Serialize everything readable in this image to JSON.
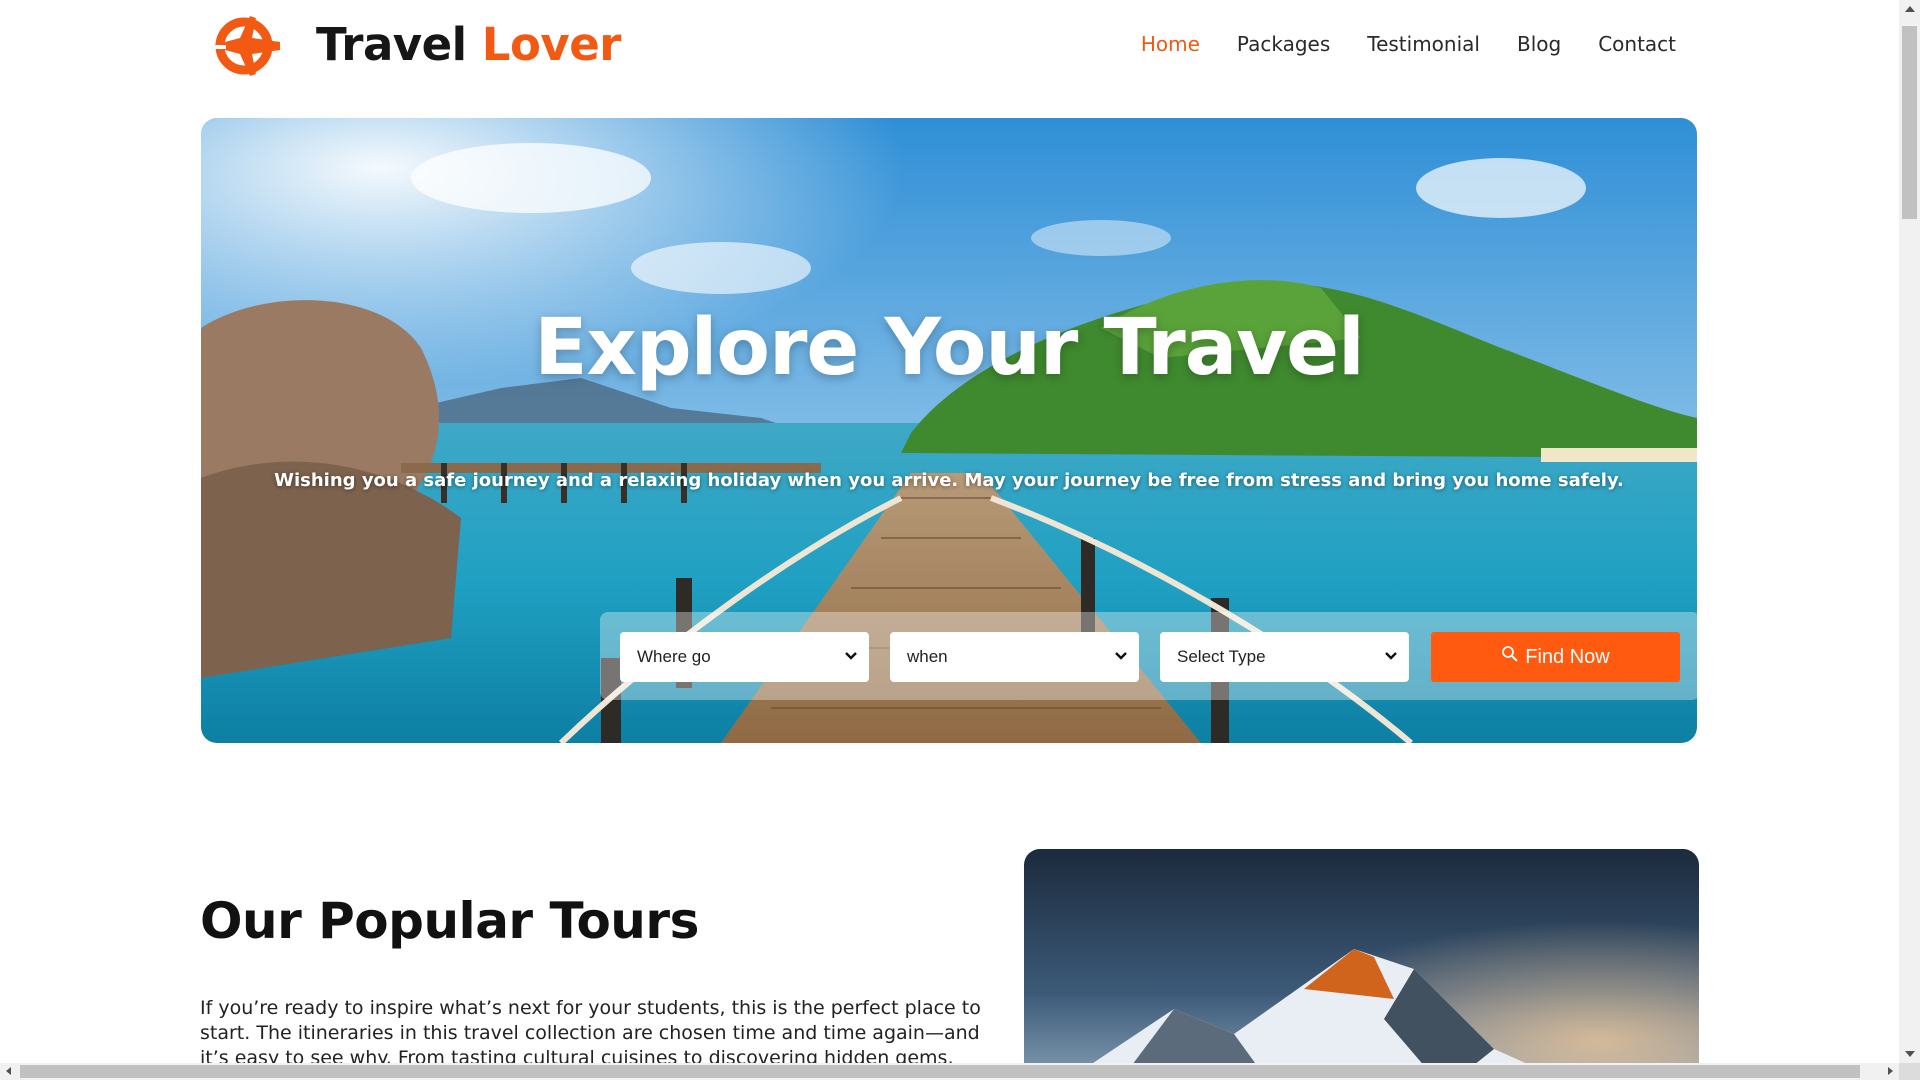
{
  "brand": {
    "name_part1": "Travel",
    "name_part2": "Lover",
    "logo_icon": "airplane-compass-icon"
  },
  "nav": {
    "items": [
      {
        "label": "Home",
        "active": true
      },
      {
        "label": "Packages",
        "active": false
      },
      {
        "label": "Testimonial",
        "active": false
      },
      {
        "label": "Blog",
        "active": false
      },
      {
        "label": "Contact",
        "active": false
      }
    ]
  },
  "hero": {
    "title": "Explore Your Travel",
    "subtitle": "Wishing you a safe journey and a relaxing holiday when you arrive. May your journey be free from stress and bring you home safely."
  },
  "search": {
    "where": "Where go",
    "when": "when",
    "type": "Select Type",
    "button_label": "Find Now",
    "button_icon": "search-icon"
  },
  "tours": {
    "title": "Our Popular Tours",
    "text": "If you’re ready to inspire what’s next for your students, this is the perfect place to start. The itineraries in this travel collection are chosen time and time again—and it’s easy to see why. From tasting cultural cuisines to discovering hidden gems, these destinations"
  },
  "colors": {
    "accent": "#f25a14",
    "button": "#ff5a0f",
    "text": "#161616"
  }
}
